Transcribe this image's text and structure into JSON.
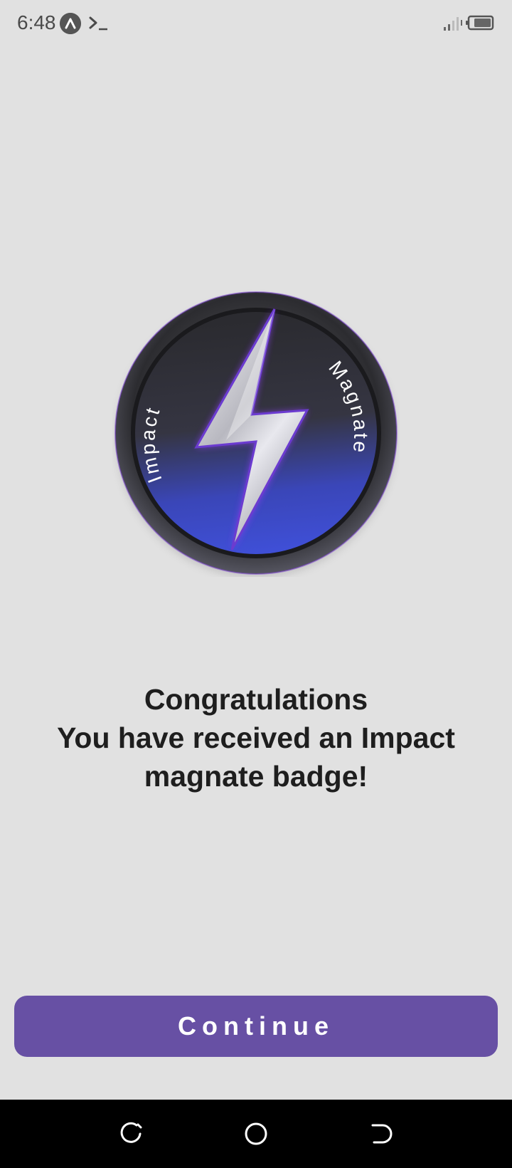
{
  "status_bar": {
    "time": "6:48",
    "icons": [
      "app-notification-icon",
      "terminal-icon",
      "signal-icon",
      "battery-icon"
    ]
  },
  "badge": {
    "left_text": "Impact",
    "right_text": "Magnate",
    "icon": "lightning-bolt-icon",
    "colors": {
      "rim": "#3a3a3e",
      "face_dark": "#2f2f35",
      "face_blue": "#3a49c9",
      "glow": "#8a3cf0",
      "bolt": "#c9c9cf"
    }
  },
  "message": {
    "line1": "Congratulations",
    "line2": "You have received an Impact",
    "line3": "magnate badge!"
  },
  "continue_button": {
    "label": "Continue",
    "color": "#6750a4"
  },
  "nav_bar": {
    "icons": [
      "recent-apps-icon",
      "home-icon",
      "back-icon"
    ]
  }
}
